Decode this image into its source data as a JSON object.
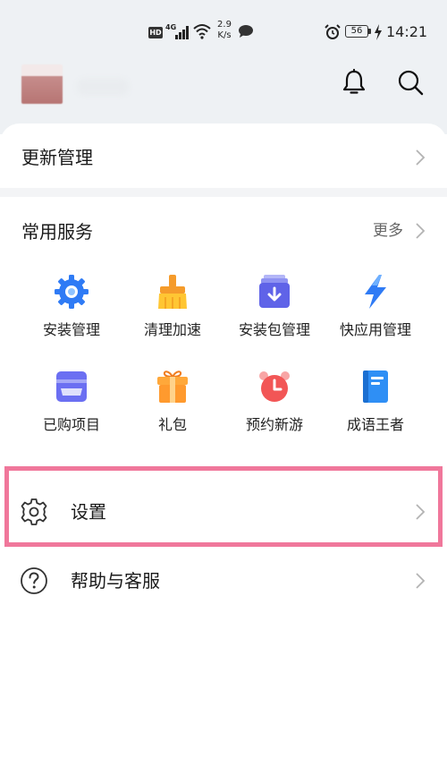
{
  "status_bar": {
    "hd": "HD",
    "network": "4G",
    "speed_value": "2.9",
    "speed_unit": "K/s",
    "battery": "56",
    "time": "14:21"
  },
  "header": {
    "icons": [
      "bell-icon",
      "search-icon"
    ]
  },
  "update_row": {
    "label": "更新管理"
  },
  "services": {
    "title": "常用服务",
    "more_label": "更多",
    "items": [
      {
        "label": "安装管理",
        "icon": "install-gear-icon",
        "color": "#2f7bf5"
      },
      {
        "label": "清理加速",
        "icon": "broom-icon",
        "color": "#ffb72b"
      },
      {
        "label": "安装包管理",
        "icon": "package-icon",
        "color": "#6a6ff0"
      },
      {
        "label": "快应用管理",
        "icon": "lightning-icon",
        "color": "#2f7bf5"
      },
      {
        "label": "已购项目",
        "icon": "wallet-icon",
        "color": "#6b6ff2"
      },
      {
        "label": "礼包",
        "icon": "gift-icon",
        "color": "#ff9a2e"
      },
      {
        "label": "预约新游",
        "icon": "alarm-clock-icon",
        "color": "#f25656"
      },
      {
        "label": "成语王者",
        "icon": "book-icon",
        "color": "#2f8ff5"
      }
    ]
  },
  "menu": {
    "settings_label": "设置",
    "help_label": "帮助与客服"
  },
  "colors": {
    "highlight_border": "#f0779b",
    "header_background": "#eef1f4"
  }
}
